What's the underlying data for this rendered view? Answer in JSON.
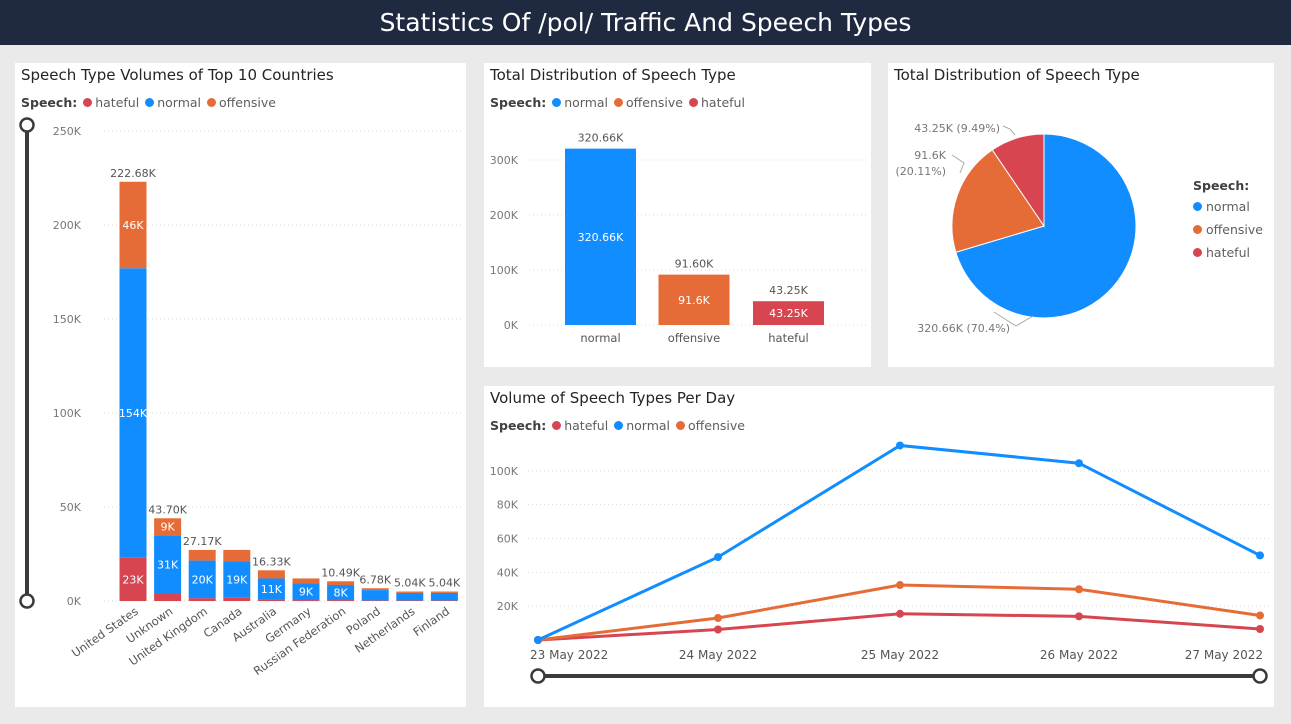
{
  "page": {
    "title": "Statistics Of /pol/ Traffic And Speech Types"
  },
  "colors": {
    "normal": "#118dff",
    "offensive": "#e66c37",
    "hateful": "#d64550",
    "slider": "#3b3b3b",
    "header": "#1f2a40"
  },
  "chart_data": [
    {
      "type": "bar",
      "stacked": true,
      "title": "Speech Type Volumes of Top 10 Countries",
      "legend_title": "Speech:",
      "legend": [
        "hateful",
        "normal",
        "offensive"
      ],
      "categories": [
        "United States",
        "Unknown",
        "United Kingdom",
        "Canada",
        "Australia",
        "Germany",
        "Russian Federation",
        "Poland",
        "Netherlands",
        "Finland"
      ],
      "series": [
        {
          "name": "hateful",
          "values": [
            23000,
            4000,
            1500,
            2000,
            1000,
            500,
            500,
            300,
            300,
            300
          ]
        },
        {
          "name": "normal",
          "values": [
            154000,
            31000,
            20000,
            19000,
            11000,
            9000,
            8000,
            5500,
            4000,
            4000
          ]
        },
        {
          "name": "offensive",
          "values": [
            46000,
            9000,
            5670,
            6170,
            4330,
            2500,
            1990,
            980,
            740,
            740
          ]
        }
      ],
      "segment_labels": [
        [
          "23K",
          "",
          "",
          "",
          "",
          "",
          "",
          "",
          "",
          ""
        ],
        [
          "154K",
          "31K",
          "20K",
          "19K",
          "11K",
          "9K",
          "8K",
          "",
          "",
          ""
        ],
        [
          "46K",
          "9K",
          "",
          "",
          "",
          "",
          "",
          "",
          "",
          ""
        ]
      ],
      "total_labels": [
        "222.68K",
        "43.70K",
        "27.17K",
        "",
        "16.33K",
        "",
        "10.49K",
        "6.78K",
        "5.04K",
        "5.04K"
      ],
      "yticks": [
        "0K",
        "50K",
        "100K",
        "150K",
        "200K",
        "250K"
      ],
      "ylim": [
        0,
        250000
      ]
    },
    {
      "type": "bar",
      "title": "Total Distribution of Speech Type",
      "legend_title": "Speech:",
      "legend": [
        "normal",
        "offensive",
        "hateful"
      ],
      "categories": [
        "normal",
        "offensive",
        "hateful"
      ],
      "values": [
        320660,
        91600,
        43250
      ],
      "top_labels": [
        "320.66K",
        "91.60K",
        "43.25K"
      ],
      "inner_labels": [
        "320.66K",
        "91.6K",
        "43.25K"
      ],
      "yticks": [
        "0K",
        "100K",
        "200K",
        "300K"
      ],
      "ylim": [
        0,
        340000
      ]
    },
    {
      "type": "pie",
      "title": "Total Distribution of Speech Type",
      "legend_title": "Speech:",
      "legend": [
        "normal",
        "offensive",
        "hateful"
      ],
      "labels": [
        "normal",
        "offensive",
        "hateful"
      ],
      "values": [
        320660,
        91600,
        43250
      ],
      "slice_labels": [
        [
          "320.66K (70.4%)"
        ],
        [
          "91.6K",
          "(20.11%)"
        ],
        [
          "43.25K (9.49%)"
        ]
      ]
    },
    {
      "type": "line",
      "title": "Volume of Speech Types Per Day",
      "legend_title": "Speech:",
      "legend": [
        "hateful",
        "normal",
        "offensive"
      ],
      "x": [
        "23 May 2022",
        "24 May 2022",
        "25 May 2022",
        "26 May 2022",
        "27 May 2022"
      ],
      "series": [
        {
          "name": "hateful",
          "values": [
            0,
            6200,
            15500,
            14000,
            6500
          ]
        },
        {
          "name": "normal",
          "values": [
            0,
            49000,
            115000,
            104500,
            50000
          ]
        },
        {
          "name": "offensive",
          "values": [
            0,
            13000,
            32500,
            30000,
            14500
          ]
        }
      ],
      "yticks": [
        "20K",
        "40K",
        "60K",
        "80K",
        "100K"
      ],
      "ylim": [
        0,
        120000
      ]
    }
  ]
}
